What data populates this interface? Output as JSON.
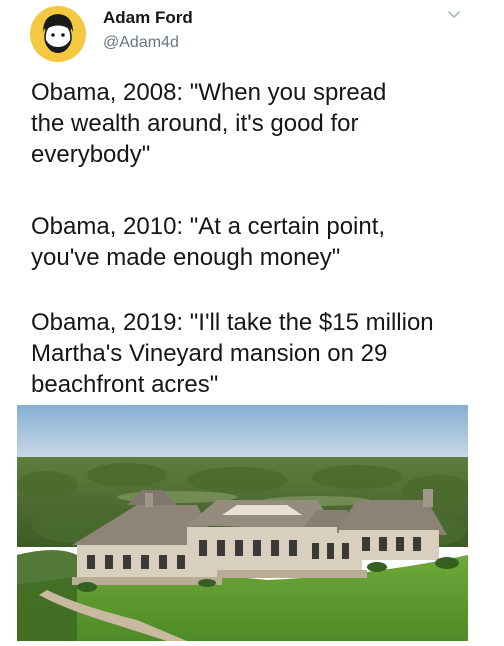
{
  "tweet": {
    "author": {
      "display_name": "Adam Ford",
      "handle": "@Adam4d",
      "avatar_icon": "cartoon-face-avatar",
      "avatar_color": "#f5c842"
    },
    "menu_icon": "chevron-down-icon",
    "quotes": [
      "Obama, 2008: \"When you spread\nthe wealth around, it's good for\neverybody\"",
      "Obama, 2010: \"At a certain point,\nyou've made enough money\"",
      "Obama, 2019: \"I'll take the $15 million\nMartha's Vineyard mansion on 29\nbeachfront acres\""
    ],
    "media": {
      "type": "photo",
      "subject": "aerial-mansion-photo"
    }
  },
  "colors": {
    "text": "#14171a",
    "secondary_text": "#657786",
    "sky": "#8fb4d6",
    "lawn": "#5e9a32"
  }
}
